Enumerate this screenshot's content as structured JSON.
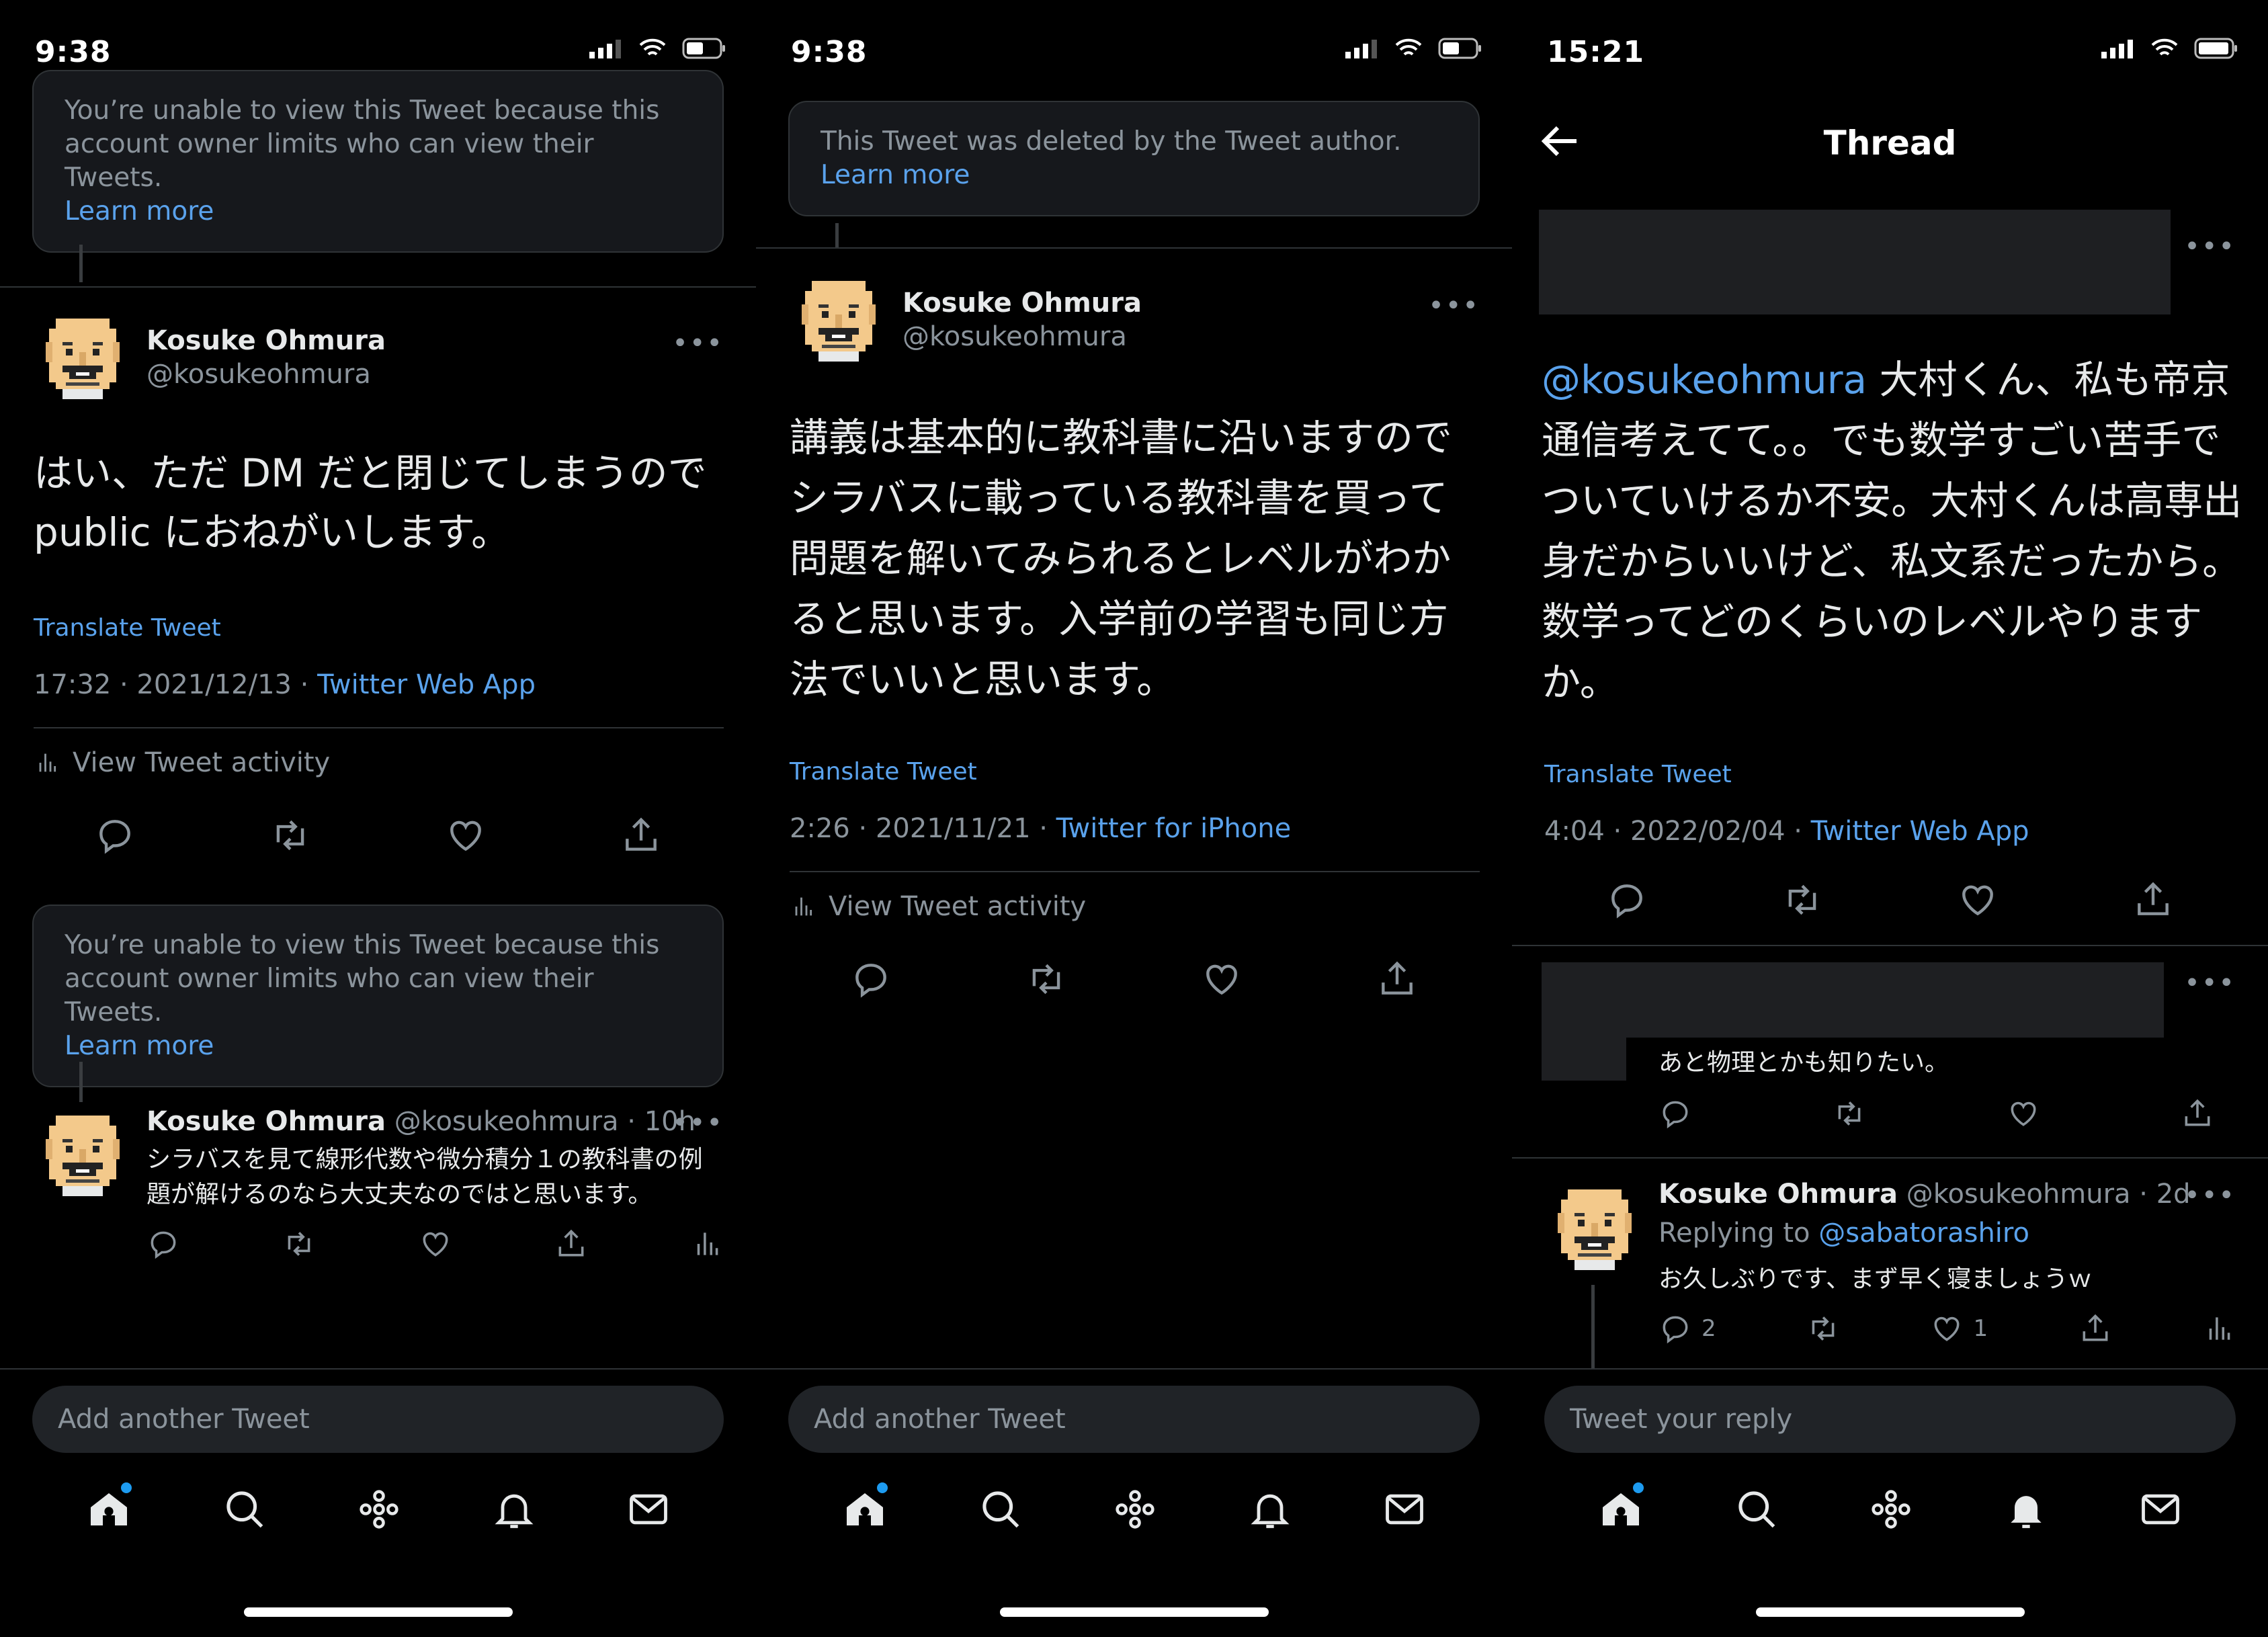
{
  "screens": [
    {
      "status_time": "9:38",
      "notice1": {
        "text": "You’re unable to view this Tweet because this account owner limits who can view their Tweets.",
        "link": "Learn more"
      },
      "tweet": {
        "name": "Kosuke Ohmura",
        "handle": "@kosukeohmura",
        "body": "はい、ただ DM だと閉じてしまうので public におねがいします。",
        "translate": "Translate Tweet",
        "timestamp": "17:32 · 2021/12/13 · ",
        "source": "Twitter Web App",
        "activity": "View Tweet activity"
      },
      "notice2": {
        "text": "You’re unable to view this Tweet because this account owner limits who can view their Tweets.",
        "link": "Learn more"
      },
      "reply": {
        "name": "Kosuke Ohmura",
        "meta": "@kosukeohmura · 10h",
        "body": "シラバスを見て線形代数や微分積分１の教科書の例題が解けるのなら大丈夫なのではと思います。"
      },
      "compose_placeholder": "Add another Tweet"
    },
    {
      "status_time": "9:38",
      "notice": {
        "text": "This Tweet was deleted by the Tweet author.",
        "link": "Learn more"
      },
      "tweet": {
        "name": "Kosuke Ohmura",
        "handle": "@kosukeohmura",
        "body": "講義は基本的に教科書に沿いますのでシラバスに載っている教科書を買って問題を解いてみられるとレベルがわかると思います。入学前の学習も同じ方法でいいと思います。",
        "translate": "Translate Tweet",
        "timestamp": "2:26 · 2021/11/21 · ",
        "source": "Twitter for iPhone",
        "activity": "View Tweet activity"
      },
      "compose_placeholder": "Add another Tweet"
    },
    {
      "status_time": "15:21",
      "header_title": "Thread",
      "tweet": {
        "mention": "@kosukeohmura",
        "body": " 大村くん、私も帝京通信考えてて。。でも数学すごい苦手でついていけるか不安。大村くんは高専出身だからいいけど、私文系だったから。数学ってどのくらいのレベルやりますか。",
        "translate": "Translate Tweet",
        "timestamp": "4:04 · 2022/02/04 · ",
        "source": "Twitter Web App"
      },
      "reply1": {
        "body": "あと物理とかも知りたい。"
      },
      "reply2": {
        "name": "Kosuke Ohmura",
        "meta": "@kosukeohmura · 2d",
        "replying_prefix": "Replying to ",
        "replying_to": "@sabatorashiro",
        "body": "お久しぶりです、まず早く寝ましょうｗ",
        "reply_count": "2",
        "like_count": "1"
      },
      "compose_placeholder": "Tweet your reply"
    }
  ],
  "colors": {
    "background": "#000000",
    "link": "#5aa2ec",
    "muted": "#8b949c",
    "card": "#16181c"
  }
}
